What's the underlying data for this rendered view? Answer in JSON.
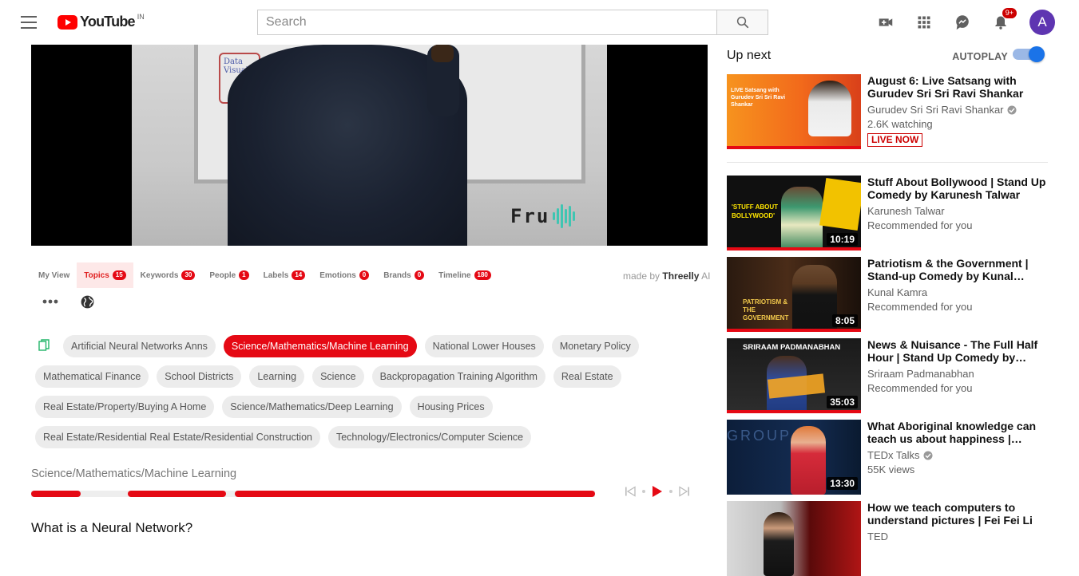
{
  "header": {
    "logo_text": "YouTube",
    "region": "IN",
    "search_placeholder": "Search",
    "notification_count": "9+",
    "avatar_letter": "A"
  },
  "player": {
    "whiteboard_note": "Data Visual",
    "watermark": "Fru"
  },
  "tabs": [
    {
      "label": "My View",
      "count": ""
    },
    {
      "label": "Topics",
      "count": "15"
    },
    {
      "label": "Keywords",
      "count": "30"
    },
    {
      "label": "People",
      "count": "1"
    },
    {
      "label": "Labels",
      "count": "14"
    },
    {
      "label": "Emotions",
      "count": "0"
    },
    {
      "label": "Brands",
      "count": "0"
    },
    {
      "label": "Timeline",
      "count": "180"
    }
  ],
  "made_by": {
    "prefix": "made by",
    "brand": "Threelly",
    "suffix": "AI"
  },
  "topics": {
    "row1": [
      "Artificial Neural Networks Anns",
      "Science/Mathematics/Machine Learning",
      "National Lower Houses",
      "Monetary Policy"
    ],
    "row2": [
      "Mathematical Finance",
      "School Districts",
      "Learning",
      "Science",
      "Backpropagation Training Algorithm",
      "Real Estate"
    ],
    "row3": [
      "Real Estate/Property/Buying A Home",
      "Science/Mathematics/Deep Learning",
      "Housing Prices"
    ],
    "row4": [
      "Real Estate/Residential Real Estate/Residential Construction",
      "Technology/Electronics/Computer Science"
    ],
    "selected": "Science/Mathematics/Machine Learning"
  },
  "timeline": {
    "segments_fraction": [
      [
        0.0,
        0.088
      ],
      [
        0.171,
        0.346
      ],
      [
        0.361,
        1.0
      ]
    ],
    "accent": "#e50914"
  },
  "video_title": "What is a Neural Network?",
  "sidebar": {
    "up_next": "Up next",
    "autoplay": "AUTOPLAY",
    "videos": [
      {
        "title": "August 6: Live Satsang with Gurudev Sri Sri Ravi Shankar",
        "channel": "Gurudev Sri Sri Ravi Shankar",
        "meta": "2.6K watching",
        "verified": true,
        "live": "LIVE NOW",
        "duration": "",
        "thumb_text": "LIVE Satsang with Gurudev Sri Sri Ravi Shankar"
      },
      {
        "title": "Stuff About Bollywood | Stand Up Comedy by Karunesh Talwar",
        "channel": "Karunesh Talwar",
        "meta": "Recommended for you",
        "verified": false,
        "live": "",
        "duration": "10:19",
        "thumb_text": "'STUFF ABOUT BOLLYWOOD'"
      },
      {
        "title": "Patriotism & the Government | Stand-up Comedy by Kunal…",
        "channel": "Kunal Kamra",
        "meta": "Recommended for you",
        "verified": false,
        "live": "",
        "duration": "8:05",
        "thumb_text": "PATRIOTISM & THE GOVERNMENT"
      },
      {
        "title": "News & Nuisance - The Full Half Hour | Stand Up Comedy by…",
        "channel": "Sriraam Padmanabhan",
        "meta": "Recommended for you",
        "verified": false,
        "live": "",
        "duration": "35:03",
        "thumb_text": "SRIRAAM PADMANABHAN"
      },
      {
        "title": "What Aboriginal knowledge can teach us about happiness |…",
        "channel": "TEDx Talks",
        "meta": "55K views",
        "verified": true,
        "live": "",
        "duration": "13:30",
        "thumb_text": "GROUP"
      },
      {
        "title": "How we teach computers to understand pictures | Fei Fei Li",
        "channel": "TED",
        "meta": "",
        "verified": true,
        "live": "",
        "duration": "",
        "thumb_text": ""
      }
    ]
  }
}
